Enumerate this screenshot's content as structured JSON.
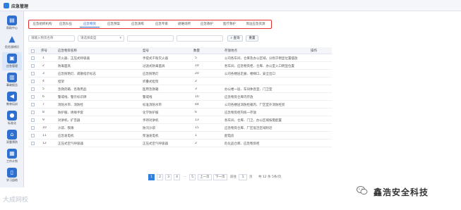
{
  "window": {
    "title": "应急管理"
  },
  "sidebar": {
    "items": [
      {
        "label": "帮助中心",
        "icon": "book-icon"
      },
      {
        "label": "危险源辨识",
        "icon": "warning-icon"
      },
      {
        "label": "应急管理",
        "icon": "emergency-icon",
        "active": true
      },
      {
        "label": "事故报告",
        "icon": "report-icon"
      },
      {
        "label": "教育培训",
        "icon": "megaphone-icon"
      },
      {
        "label": "标准化",
        "icon": "users-icon"
      },
      {
        "label": "双重预防",
        "icon": "home-icon"
      },
      {
        "label": "工作计划",
        "icon": "calendar-icon"
      },
      {
        "label": "学习园地",
        "icon": "book-open-icon"
      }
    ]
  },
  "tabs": [
    {
      "label": "应急组织机构"
    },
    {
      "label": "应急队伍"
    },
    {
      "label": "应急物资",
      "active": true
    },
    {
      "label": "应急预案"
    },
    {
      "label": "应急演练"
    },
    {
      "label": "应急专家"
    },
    {
      "label": "避难场所"
    },
    {
      "label": "应急救护"
    },
    {
      "label": "医疗救护"
    },
    {
      "label": "周边应急资源"
    }
  ],
  "filters": {
    "name_placeholder": "请输入物资名称",
    "category_value": "请选择类型",
    "search_label": "查询",
    "reset_label": "重置"
  },
  "table": {
    "columns": [
      "序号",
      "应急物资名称",
      "型号",
      "数量",
      "存放地点",
      "操作"
    ],
    "rows": [
      {
        "no": "1",
        "name": "灭火器、正压式呼吸器",
        "model": "手提式干粉灭火器",
        "qty": "5",
        "location": "公司各车间、仓库及办公区域，分别于明显位置摆放"
      },
      {
        "no": "2",
        "name": "防毒面具",
        "model": "过滤式防毒面具",
        "qty": "10",
        "location": "各车间、应急物资柜、仓库、办公室入口明显位置"
      },
      {
        "no": "3",
        "name": "应急照明灯、疏散指示标志",
        "model": "应急照明灯",
        "qty": "20",
        "location": "公司各楼层走廊、楼梯口、安全出口"
      },
      {
        "no": "4",
        "name": "担架",
        "model": "折叠式担架",
        "qty": "2",
        "location": ""
      },
      {
        "no": "5",
        "name": "急救药箱、急救用品",
        "model": "医用急救箱",
        "qty": "3",
        "location": "办公楼一层、车间休息室、门卫室"
      },
      {
        "no": "6",
        "name": "警戒线、警示标识牌",
        "model": "警戒线",
        "qty": "10",
        "location": "应急物资仓库内存放"
      },
      {
        "no": "7",
        "name": "消防水带、消防栓",
        "model": "标准消防水带",
        "qty": "44",
        "location": "公司各楼层消防栓箱内、厂区室外消防栓旁"
      },
      {
        "no": "8",
        "name": "防护服、绝缘手套",
        "model": "化学防护服",
        "qty": "6",
        "location": "应急物资柜内统一存放"
      },
      {
        "no": "9",
        "name": "对讲机、扩音器",
        "model": "手持对讲机",
        "qty": "13",
        "location": "各车间、仓库、门卫、办公区域按需配置"
      },
      {
        "no": "10",
        "name": "沙袋、铁锹",
        "model": "防汛沙袋",
        "qty": "15",
        "location": "应急物资仓库、厂区低洼区域附近"
      },
      {
        "no": "11",
        "name": "应急发电机",
        "model": "柴油发电机",
        "qty": "1",
        "location": "配电房"
      },
      {
        "no": "12",
        "name": "正压式空气呼吸器",
        "model": "正压式空气呼吸器",
        "qty": "2",
        "location": "危化品仓库、应急物资柜"
      }
    ]
  },
  "pagination": {
    "pages": [
      "1",
      "2",
      "3",
      "4",
      "...",
      "5"
    ],
    "current": "1",
    "prev_label": "上一页",
    "next_label": "下一页",
    "goto_label": "前往",
    "page_input": "1",
    "page_unit": "页",
    "total_label": "共 12 条 5条/页"
  },
  "watermarks": {
    "left": "大成网校",
    "right": "鑫浩安全科技"
  },
  "colors": {
    "accent": "#2f7fe0",
    "highlight_border": "#e02f2f"
  }
}
